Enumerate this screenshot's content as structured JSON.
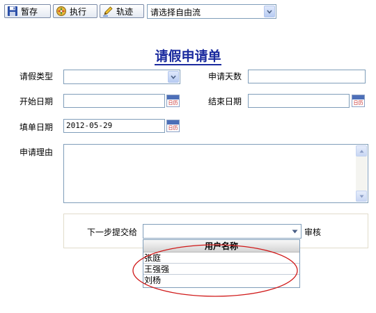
{
  "toolbar": {
    "save_label": "暂存",
    "execute_label": "执行",
    "trace_label": "轨迹",
    "flow_select_value": "请选择自由流"
  },
  "form": {
    "title": "请假申请单",
    "leave_type_label": "请假类型",
    "leave_type_value": "",
    "days_label": "申请天数",
    "days_value": "",
    "start_date_label": "开始日期",
    "start_date_value": "",
    "end_date_label": "结束日期",
    "end_date_value": "",
    "fill_date_label": "填单日期",
    "fill_date_value": "2012-05-29",
    "reason_label": "申请理由",
    "reason_value": "",
    "calendar_icon_text": "日历"
  },
  "submit": {
    "next_step_label": "下一步提交给",
    "next_step_value": "",
    "review_label": "审核",
    "dropdown_header": "用户名称",
    "users": [
      "张庭",
      "王强强",
      "刘杨"
    ]
  },
  "colors": {
    "title": "#1a2a9e",
    "annotation_ellipse": "#d01818",
    "field_border": "#7f9db9"
  }
}
